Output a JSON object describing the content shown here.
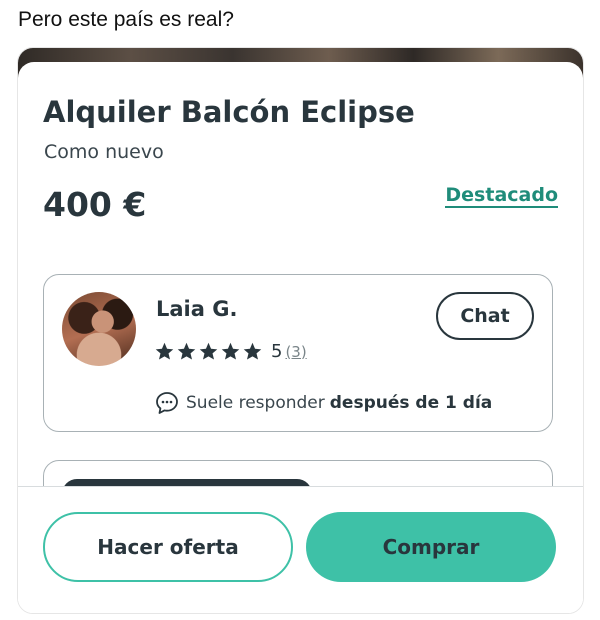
{
  "caption": "Pero este país es real?",
  "listing": {
    "title": "Alquiler Balcón Eclipse",
    "condition": "Como nuevo",
    "price": "400 €",
    "featured_label": "Destacado"
  },
  "seller": {
    "name": "Laia G.",
    "rating_value": "5",
    "rating_count": "(3)",
    "star_count": 5,
    "chat_label": "Chat",
    "response_prefix": "Suele responder",
    "response_time": "después de 1 día"
  },
  "actions": {
    "offer_label": "Hacer oferta",
    "buy_label": "Comprar"
  },
  "colors": {
    "accent": "#3ec1a7",
    "featured": "#1f8c7a",
    "text": "#29363d"
  }
}
